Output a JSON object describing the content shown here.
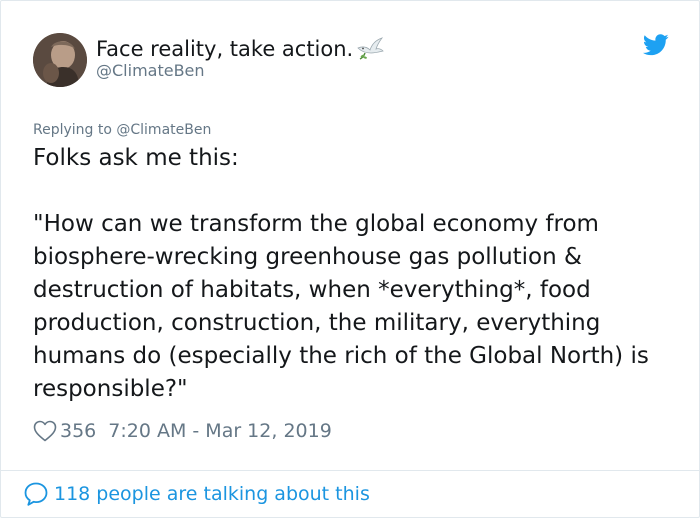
{
  "author": {
    "display_name": "Face reality, take action.",
    "name_emoji_icon": "dove-icon",
    "handle": "@ClimateBen",
    "avatar_icon": "avatar"
  },
  "platform_icon": "twitter-bird-icon",
  "reply_context": {
    "label": "Replying to @ClimateBen"
  },
  "tweet": {
    "text": "Folks ask me this:\n\n\"How can we transform the global economy from biosphere-wrecking greenhouse gas pollution & destruction of habitats, when *everything*, food production, construction, the military, everything humans do (especially the rich of the Global North) is responsible?\""
  },
  "meta": {
    "like_icon": "heart-icon",
    "likes": "356",
    "timestamp": "7:20 AM - Mar 12, 2019"
  },
  "footer": {
    "icon": "speech-bubble-icon",
    "talking_label": "118 people are talking about this"
  },
  "colors": {
    "text": "#14171a",
    "secondary": "#657786",
    "link": "#1b95e0",
    "twitter_blue": "#1da1f2",
    "border": "#e1e8ed"
  }
}
